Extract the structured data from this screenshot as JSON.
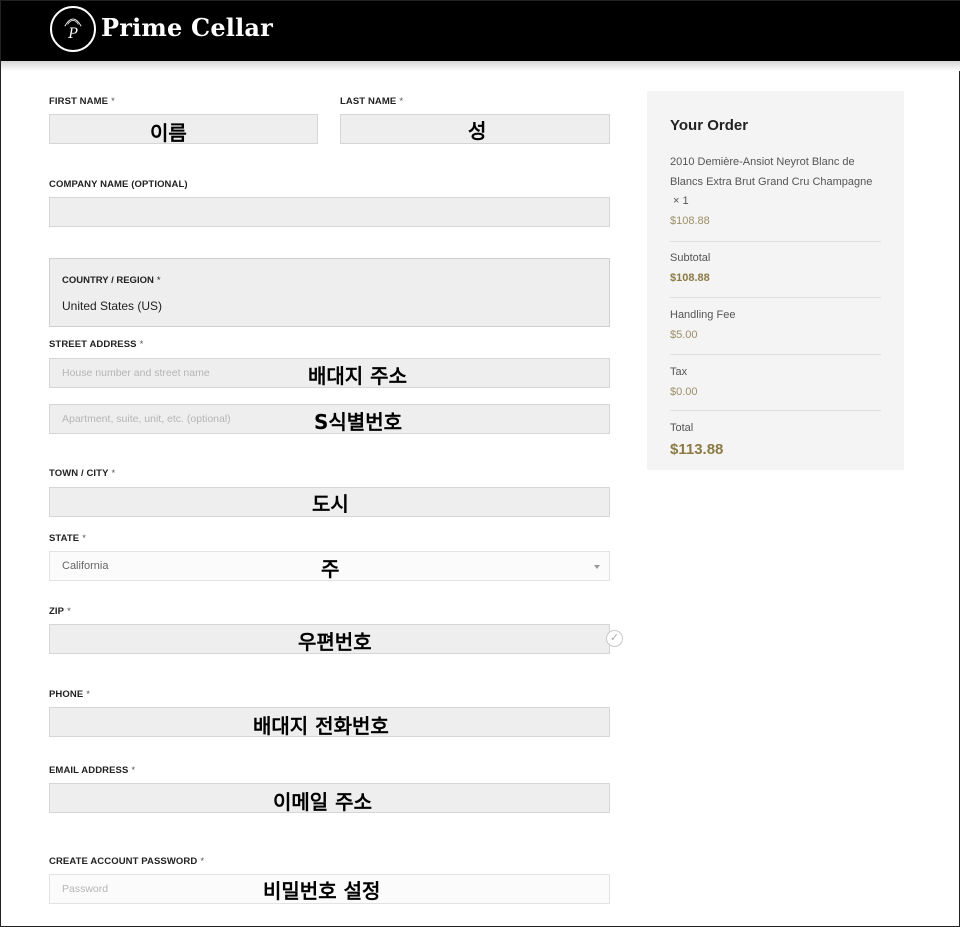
{
  "header": {
    "brand": "Prime Cellar",
    "logo_monogram": "P"
  },
  "form": {
    "first_name": {
      "label": "FIRST NAME",
      "req": "*",
      "note": "이름"
    },
    "last_name": {
      "label": "LAST NAME",
      "req": "*",
      "note": "성"
    },
    "company": {
      "label": "COMPANY NAME (OPTIONAL)"
    },
    "country": {
      "label": "COUNTRY / REGION",
      "req": "*",
      "value": "United States (US)"
    },
    "street": {
      "label": "STREET ADDRESS",
      "req": "*",
      "placeholder1": "House number and street name",
      "note1": "배대지 주소",
      "placeholder2": "Apartment, suite, unit, etc. (optional)",
      "note2": "S식별번호"
    },
    "city": {
      "label": "TOWN / CITY",
      "req": "*",
      "note": "도시"
    },
    "state": {
      "label": "STATE",
      "req": "*",
      "value": "California",
      "note": "주"
    },
    "zip": {
      "label": "ZIP",
      "req": "*",
      "note": "우편번호",
      "check": "✓"
    },
    "phone": {
      "label": "PHONE",
      "req": "*",
      "note": "배대지 전화번호"
    },
    "email": {
      "label": "EMAIL ADDRESS",
      "req": "*",
      "note": "이메일 주소"
    },
    "password": {
      "label": "CREATE ACCOUNT PASSWORD",
      "req": "*",
      "placeholder": "Password",
      "note": "비밀번호 설정"
    }
  },
  "order": {
    "title": "Your Order",
    "product_name": "2010 Demière-Ansiot Neyrot Blanc de Blancs Extra Brut Grand Cru Champagne",
    "product_qty": "× 1",
    "product_price": "$108.88",
    "subtotal_label": "Subtotal",
    "subtotal_value": "$108.88",
    "handling_label": "Handling Fee",
    "handling_value": "$5.00",
    "tax_label": "Tax",
    "tax_value": "$0.00",
    "total_label": "Total",
    "total_value": "$113.88"
  },
  "colors": {
    "header_bg": "#000000",
    "field_bg": "#eeeeee",
    "accent_gold": "#8c7a45"
  }
}
